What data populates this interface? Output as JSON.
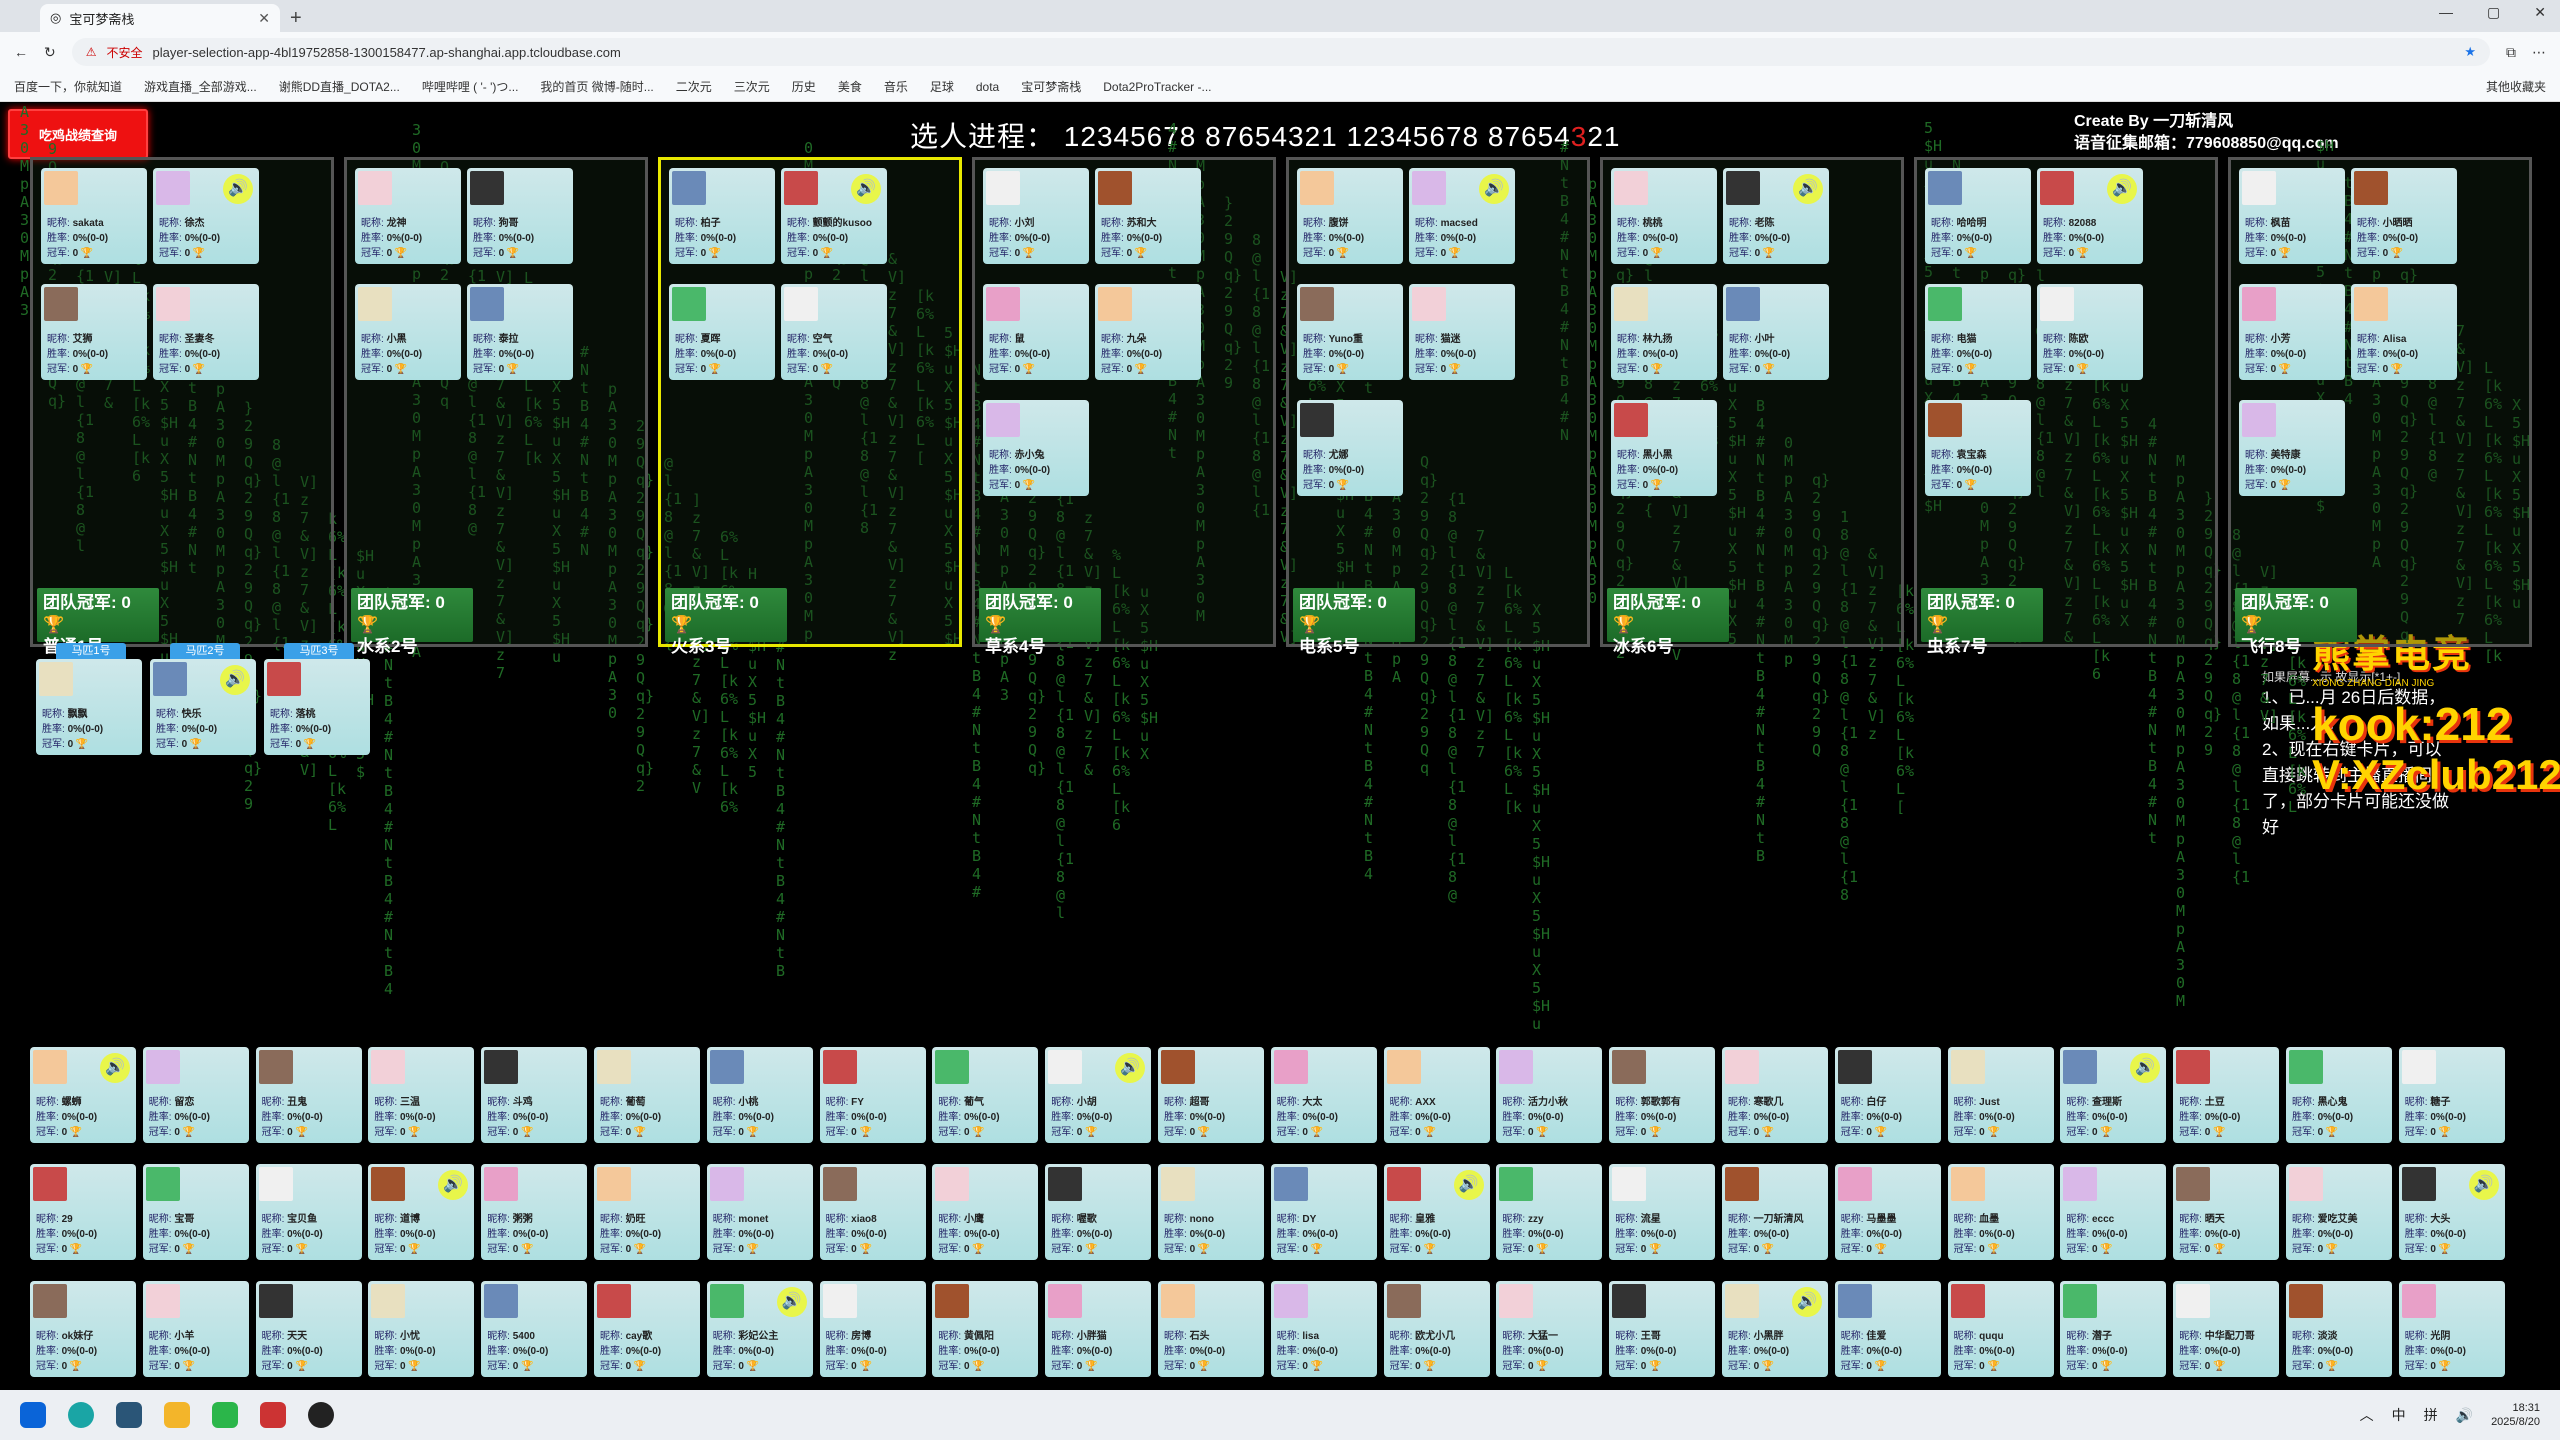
{
  "browser": {
    "tab_title": "宝可梦斋栈",
    "url_security": "不安全",
    "url": "player-selection-app-4bl19752858-1300158477.ap-shanghai.app.tcloudbase.com",
    "bookmarks": [
      "百度一下，你就知道",
      "游戏直播_全部游戏...",
      "谢熊DD直播_DOTA2...",
      "哔哩哔哩 ( '- ')つ...",
      "我的首页 微博-随时...",
      "二次元",
      "三次元",
      "历史",
      "美食",
      "音乐",
      "足球",
      "dota",
      "宝可梦斋栈",
      "Dota2ProTracker -..."
    ],
    "other_bookmarks": "其他收藏夹"
  },
  "app": {
    "query_button": "吃鸡战绩查询",
    "progress_label": "选人进程：",
    "progress_value_a": "12345678 87654321 12345678 87654",
    "progress_value_hl": "3",
    "progress_value_b": "21",
    "credit_line1": "Create By 一刀斩清风",
    "credit_line2": "语音征集邮箱：779608850@qq.com",
    "team_cup_label": "团队冠军: 0",
    "teams": [
      {
        "name": "普通1号",
        "active": false
      },
      {
        "name": "水系2号",
        "active": false
      },
      {
        "name": "火系3号",
        "active": true
      },
      {
        "name": "草系4号",
        "active": false
      },
      {
        "name": "电系5号",
        "active": false
      },
      {
        "name": "冰系6号",
        "active": false
      },
      {
        "name": "虫系7号",
        "active": false
      },
      {
        "name": "飞行8号",
        "active": false
      }
    ],
    "card_labels": {
      "nick": "昵称:",
      "rate": "胜率:",
      "champ": "冠军:"
    },
    "card_rate": "0%(0-0)",
    "card_champ": "0",
    "team_cards": [
      [
        "sakata",
        "徐杰",
        "艾狮",
        "圣妻冬"
      ],
      [
        "龙神",
        "狗哥",
        "小黑",
        "泰拉"
      ],
      [
        "柏子",
        "颤颤的kusoo",
        "夏晖",
        "空气"
      ],
      [
        "小刘",
        "苏和大",
        "鼠",
        "九朵",
        "赤小兔"
      ],
      [
        "腹饼",
        "macsed",
        "Yuno重",
        "猫迷",
        "尤娜"
      ],
      [
        "桃桃",
        "老陈",
        "林九扬",
        "小叶",
        "黑小黑"
      ],
      [
        "哈哈明",
        "82088",
        "电猫",
        "陈欧",
        "袁宝森"
      ],
      [
        "枫苗",
        "小晒晒",
        "小芳",
        "Alisa",
        "美特康"
      ]
    ],
    "horses": [
      {
        "ribbon": "马匹1号",
        "name": "飘飘"
      },
      {
        "ribbon": "马匹2号",
        "name": "快乐"
      },
      {
        "ribbon": "马匹3号",
        "name": "落桃"
      }
    ],
    "pool": [
      [
        "螺蛳",
        "留恋",
        "丑鬼",
        "三温",
        "斗鸡",
        "葡萄",
        "小桃",
        "FY",
        "葡气",
        "小胡",
        "超哥",
        "大太",
        "AXX",
        "活力小秋",
        "郭歌郭有",
        "寒歌几",
        "白仔",
        "Just",
        "查理斯",
        "土豆",
        "黑心鬼",
        "糖子"
      ],
      [
        "29",
        "宝哥",
        "宝贝鱼",
        "道博",
        "粥粥",
        "奶旺",
        "monet",
        "xiao8",
        "小鹰",
        "喔歌",
        "nono",
        "DY",
        "皇雅",
        "zzy",
        "流星",
        "一刀斩清风",
        "马墨墨",
        "血墨",
        "eccc",
        "晒天",
        "爱吃艾美",
        "大头"
      ],
      [
        "ok妹仔",
        "小羊",
        "天天",
        "小忧",
        "5400",
        "cay歌",
        "彩妃公主",
        "房博",
        "黄佩阳",
        "小胖猫",
        "石头",
        "lisa",
        "欧尤小几",
        "大猛一",
        "王哥",
        "小黑胖",
        "佳爱",
        "ququ",
        "潜子",
        "中华配刀哥",
        "淡淡",
        "光阴"
      ]
    ],
    "notice_small": "如果屏幕...示 故显示[*1+-]",
    "notice_lines": [
      "1、已...月 26日后数据，",
      "如果...刀，",
      "2、现在右键卡片，可以直接跳转到主播直播间了，部分卡片可能还没做好"
    ],
    "promo_brand": "熊掌电竞",
    "promo_sub": "XIONG ZHANG DIAN JING",
    "promo_kook": "kook:212",
    "promo_v": "V:XZclub212"
  },
  "taskbar": {
    "time": "18:31",
    "date": "2025/8/20",
    "ime": "中",
    "ime2": "拼"
  }
}
